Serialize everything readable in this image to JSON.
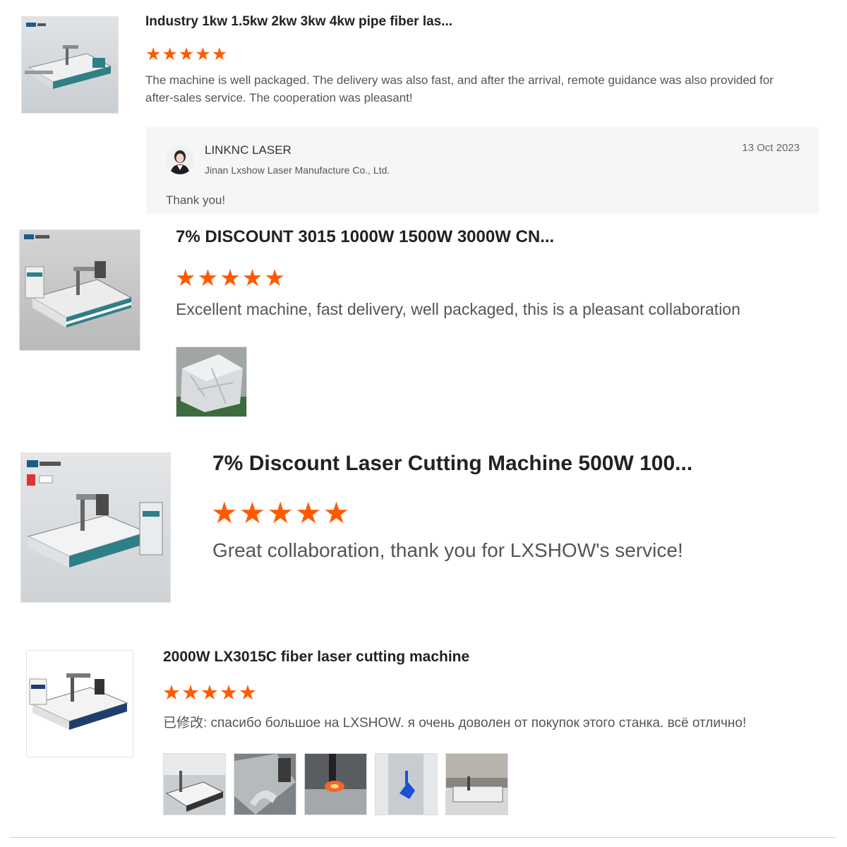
{
  "colors": {
    "star": "#ff5a00",
    "reply_bg": "#f5f6f8",
    "machine_teal": "#2e7f86"
  },
  "reviews": [
    {
      "product_title": "Industry 1kw 1.5kw 2kw 3kw 4kw pipe fiber las...",
      "rating": 5,
      "text": "The machine is well packaged. The delivery was also fast, and after the arrival, remote guidance was also provided for after-sales service. The cooperation was pleasant!",
      "reply": {
        "name": "LINKNC LASER",
        "company": "Jinan Lxshow Laser Manufacture Co., Ltd.",
        "date": "13 Oct 2023",
        "message": "Thank you!"
      }
    },
    {
      "product_title": "7% DISCOUNT 3015 1000W 1500W 3000W CN...",
      "rating": 5,
      "text": "Excellent machine, fast delivery, well packaged, this is a pleasant collaboration",
      "photo_count": 1
    },
    {
      "product_title": "7% Discount Laser Cutting Machine 500W 100...",
      "rating": 5,
      "text": "Great collaboration, thank you for LXSHOW's service!"
    },
    {
      "product_title": "2000W LX3015C fiber laser cutting machine",
      "rating": 5,
      "text_prefix": "已修改:",
      "text": " спасибо большое на LXSHOW. я очень доволен от покупок этого станка. всё отлично!",
      "photo_count": 5
    }
  ]
}
